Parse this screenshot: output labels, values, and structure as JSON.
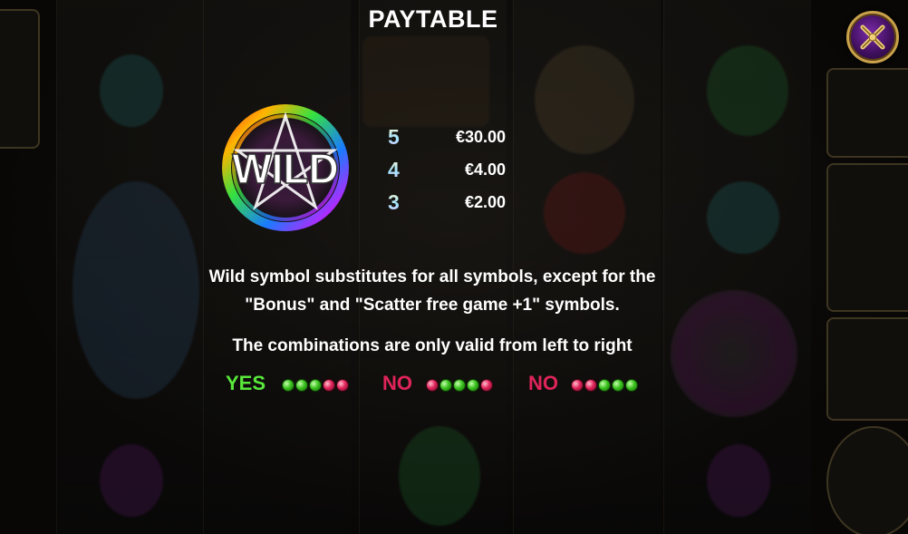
{
  "title": "PAYTABLE",
  "close_button": {
    "icon": "close-x-icon"
  },
  "symbol": {
    "name": "WILD",
    "icon": "wild-pentagram-icon"
  },
  "payouts": [
    {
      "count": "5",
      "value": "€30.00"
    },
    {
      "count": "4",
      "value": "€4.00"
    },
    {
      "count": "3",
      "value": "€2.00"
    }
  ],
  "description": {
    "line1": "Wild symbol substitutes for all symbols, except for the",
    "line2": "\"Bonus\" and \"Scatter free game +1\" symbols.",
    "rule": "The combinations are only valid from left to right"
  },
  "combinations": [
    {
      "label": "YES",
      "color": "#58e83a",
      "dots": [
        "green",
        "green",
        "green",
        "red",
        "red"
      ]
    },
    {
      "label": "NO",
      "color": "#e0245a",
      "dots": [
        "red",
        "green",
        "green",
        "green",
        "red"
      ]
    },
    {
      "label": "NO",
      "color": "#e0245a",
      "dots": [
        "red",
        "red",
        "green",
        "green",
        "green"
      ]
    }
  ],
  "colors": {
    "title": "#ffffff",
    "accent_gold": "#c9a24a",
    "yes_green": "#58e83a",
    "no_red": "#e0245a"
  }
}
